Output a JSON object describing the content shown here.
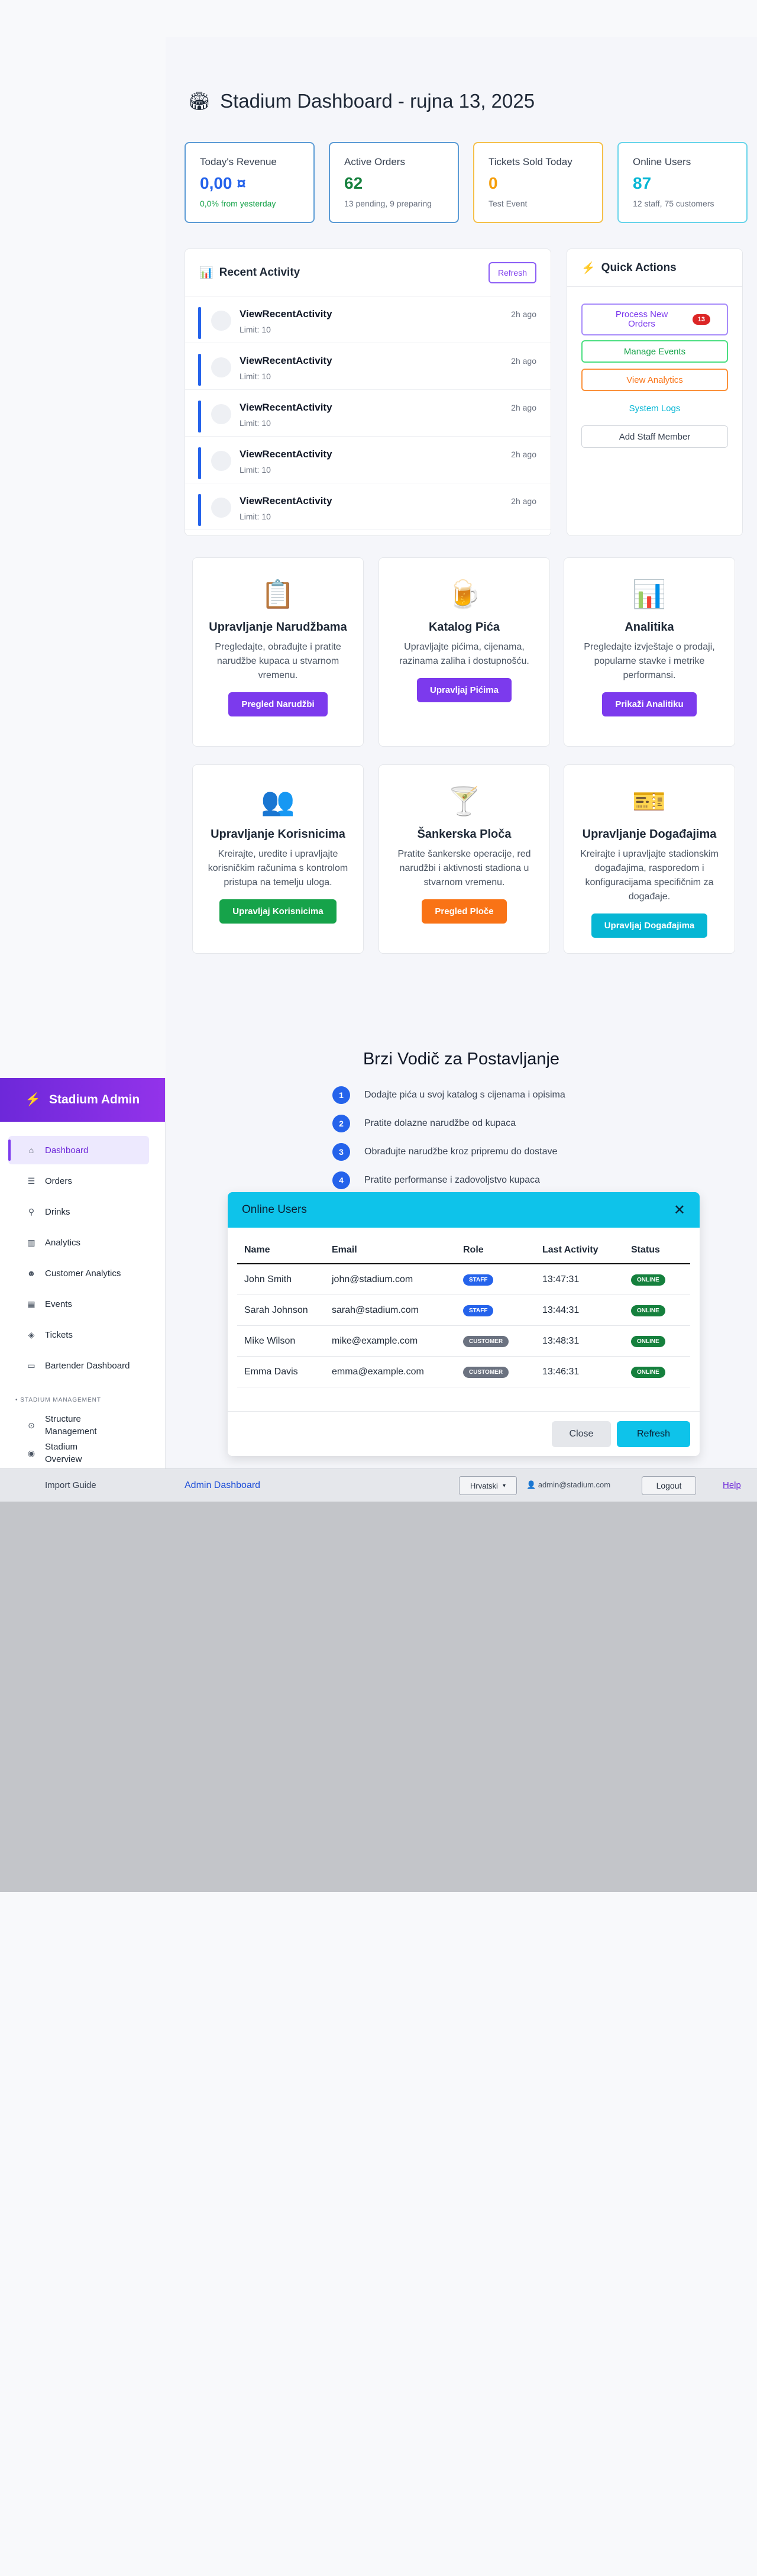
{
  "header": {
    "title": "Stadium Dashboard - rujna 13, 2025",
    "icon": "stadium-icon"
  },
  "stats": [
    {
      "label": "Today's Revenue",
      "value": "0,00 ¤",
      "sub": "0,0% from yesterday",
      "color": "#2563eb",
      "sub_color": "#16a34a",
      "border": "#5b9bd5"
    },
    {
      "label": "Active Orders",
      "value": "62",
      "sub": "13 pending, 9 preparing",
      "color": "#15803d",
      "sub_color": "#6b7280",
      "border": "#5b9bd5"
    },
    {
      "label": "Tickets Sold Today",
      "value": "0",
      "sub": "Test Event",
      "color": "#f59e0b",
      "sub_color": "#6b7280",
      "border": "#f5c04a"
    },
    {
      "label": "Online Users",
      "value": "87",
      "sub": "12 staff, 75 customers",
      "color": "#06b6d4",
      "sub_color": "#6b7280",
      "border": "#67d4ea"
    }
  ],
  "recent": {
    "title": "Recent Activity",
    "refresh_label": "Refresh",
    "items": [
      {
        "name": "ViewRecentActivity",
        "limit": "Limit: 10",
        "time": "2h ago"
      },
      {
        "name": "ViewRecentActivity",
        "limit": "Limit: 10",
        "time": "2h ago"
      },
      {
        "name": "ViewRecentActivity",
        "limit": "Limit: 10",
        "time": "2h ago"
      },
      {
        "name": "ViewRecentActivity",
        "limit": "Limit: 10",
        "time": "2h ago"
      },
      {
        "name": "ViewRecentActivity",
        "limit": "Limit: 10",
        "time": "2h ago"
      }
    ]
  },
  "quick": {
    "title": "Quick Actions",
    "process_orders": "Process New Orders",
    "process_badge": "13",
    "manage_events": "Manage Events",
    "view_analytics": "View Analytics",
    "system_logs": "System Logs",
    "add_staff": "Add Staff Member"
  },
  "features": [
    {
      "title": "Upravljanje Narudžbama",
      "desc": "Pregledajte, obrađujte i pratite narudžbe kupaca u stvarnom vremenu.",
      "btn": "Pregled Narudžbi",
      "color": "#7c3aed",
      "icon": "clipboard-icon",
      "glyph": "📋"
    },
    {
      "title": "Katalog Pića",
      "desc": "Upravljajte pićima, cijenama, razinama zaliha i dostupnošću.",
      "btn": "Upravljaj Pićima",
      "color": "#7c3aed",
      "icon": "beer-icon",
      "glyph": "🍺"
    },
    {
      "title": "Analitika",
      "desc": "Pregledajte izvještaje o prodaji, popularne stavke i metrike performansi.",
      "btn": "Prikaži Analitiku",
      "color": "#7c3aed",
      "icon": "bar-chart-icon",
      "glyph": "📊"
    },
    {
      "title": "Upravljanje Korisnicima",
      "desc": "Kreirajte, uredite i upravljajte korisničkim računima s kontrolom pristupa na temelju uloga.",
      "btn": "Upravljaj Korisnicima",
      "color": "#16a34a",
      "icon": "users-icon",
      "glyph": "👥"
    },
    {
      "title": "Šankerska Ploča",
      "desc": "Pratite šankerske operacije, red narudžbi i aktivnosti stadiona u stvarnom vremenu.",
      "btn": "Pregled Ploče",
      "color": "#f97316",
      "icon": "cocktail-icon",
      "glyph": "🍸"
    },
    {
      "title": "Upravljanje Događajima",
      "desc": "Kreirajte i upravljajte stadionskim događajima, rasporedom i konfiguracijama specifičnim za događaje.",
      "btn": "Upravljaj Događajima",
      "color": "#06b6d4",
      "icon": "ticket-icon",
      "glyph": "🎫"
    }
  ],
  "guide": {
    "title": "Brzi Vodič za Postavljanje",
    "steps": [
      {
        "num": "1",
        "text": "Dodajte pića u svoj katalog s cijenama i opisima"
      },
      {
        "num": "2",
        "text": "Pratite dolazne narudžbe od kupaca"
      },
      {
        "num": "3",
        "text": "Obrađujte narudžbe kroz pripremu do dostave"
      },
      {
        "num": "4",
        "text": "Pratite performanse i zadovoljstvo kupaca"
      }
    ]
  },
  "modal": {
    "title": "Online Users",
    "columns": [
      "Name",
      "Email",
      "Role",
      "Last Activity",
      "Status"
    ],
    "rows": [
      {
        "name": "John Smith",
        "email": "john@stadium.com",
        "role": "STAFF",
        "role_color": "#2563eb",
        "time": "13:47:31",
        "status": "ONLINE"
      },
      {
        "name": "Sarah Johnson",
        "email": "sarah@stadium.com",
        "role": "STAFF",
        "role_color": "#2563eb",
        "time": "13:44:31",
        "status": "ONLINE"
      },
      {
        "name": "Mike Wilson",
        "email": "mike@example.com",
        "role": "CUSTOMER",
        "role_color": "#6b7280",
        "time": "13:48:31",
        "status": "ONLINE"
      },
      {
        "name": "Emma Davis",
        "email": "emma@example.com",
        "role": "CUSTOMER",
        "role_color": "#6b7280",
        "time": "13:46:31",
        "status": "ONLINE"
      }
    ],
    "close_label": "Close",
    "refresh_label": "Refresh"
  },
  "sidebar": {
    "title": "Stadium Admin",
    "items": [
      {
        "label": "Dashboard",
        "icon": "home-icon",
        "glyph": "⌂"
      },
      {
        "label": "Orders",
        "icon": "list-icon",
        "glyph": "☰"
      },
      {
        "label": "Drinks",
        "icon": "drinks-icon",
        "glyph": "⚲"
      },
      {
        "label": "Analytics",
        "icon": "chart-icon",
        "glyph": "▥"
      },
      {
        "label": "Customer Analytics",
        "icon": "users-icon",
        "glyph": "☻"
      },
      {
        "label": "Events",
        "icon": "calendar-icon",
        "glyph": "▦"
      },
      {
        "label": "Tickets",
        "icon": "tag-icon",
        "glyph": "◈"
      },
      {
        "label": "Bartender Dashboard",
        "icon": "monitor-icon",
        "glyph": "▭"
      }
    ],
    "section_label": "STADIUM MANAGEMENT",
    "mgmt_items": [
      {
        "label": "Structure Management",
        "icon": "location-icon",
        "glyph": "⊙"
      },
      {
        "label": "Stadium Overview",
        "icon": "eye-icon",
        "glyph": "◉"
      }
    ]
  },
  "footer": {
    "import_guide": "Import Guide",
    "title": "Admin Dashboard",
    "language": "Hrvatski",
    "user": "admin@stadium.com",
    "logout": "Logout",
    "help": "Help"
  }
}
